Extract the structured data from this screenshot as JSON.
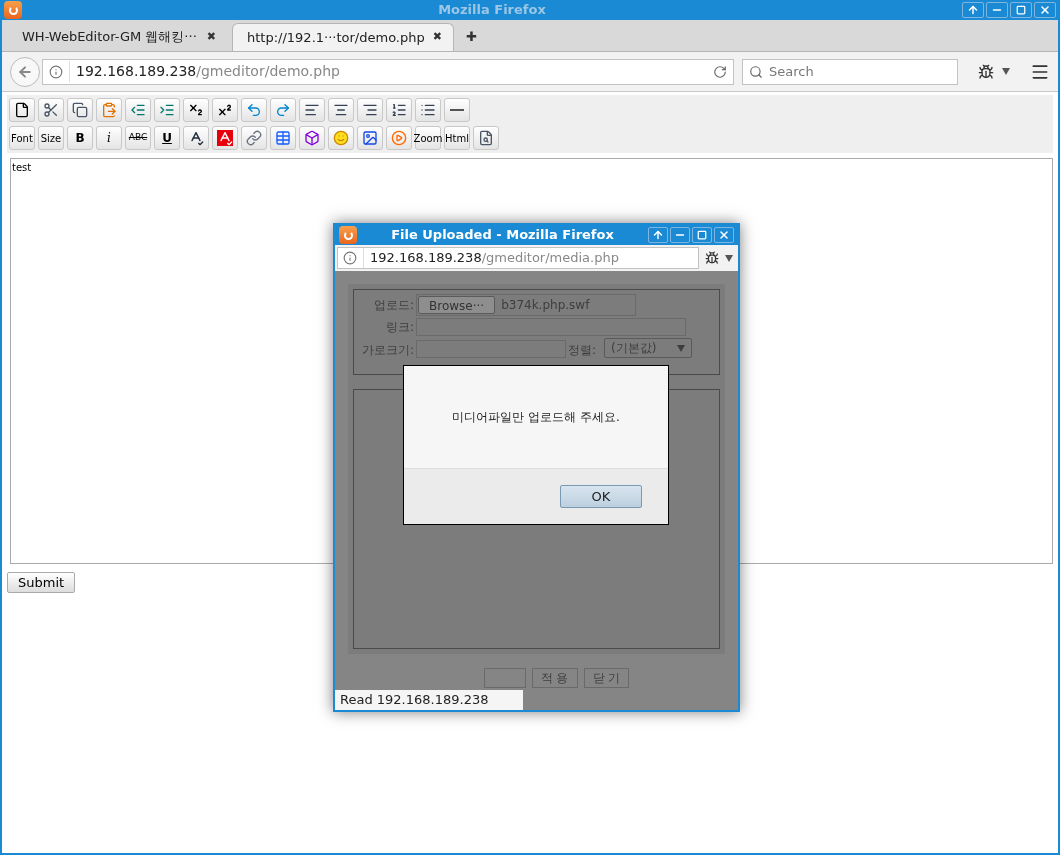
{
  "window": {
    "title": "Mozilla Firefox"
  },
  "tabs": [
    {
      "label": "WH-WebEditor-GM 웹해킹···",
      "close": "✖",
      "selected": false
    },
    {
      "label": "http://192.1···tor/demo.php",
      "close": "✖",
      "selected": true
    }
  ],
  "new_tab": "✚",
  "address_bar": {
    "host": "192.168.189.238",
    "path": "/gmeditor/demo.php"
  },
  "search": {
    "placeholder": "Search"
  },
  "toolbar": [
    [
      {
        "kind": "icon"
      },
      {
        "kind": "icon"
      },
      {
        "kind": "icon"
      },
      {
        "kind": "icon"
      },
      {
        "kind": "icon"
      },
      {
        "kind": "icon"
      },
      {
        "kind": "icon"
      },
      {
        "kind": "icon"
      },
      {
        "kind": "icon"
      },
      {
        "kind": "icon"
      },
      {
        "kind": "icon"
      },
      {
        "kind": "icon"
      },
      {
        "kind": "icon"
      },
      {
        "kind": "icon"
      },
      {
        "kind": "icon"
      },
      {
        "kind": "icon"
      }
    ],
    [
      {
        "kind": "text",
        "label": "Font"
      },
      {
        "kind": "text",
        "label": "Size"
      },
      {
        "kind": "bold",
        "label": "B"
      },
      {
        "kind": "italic",
        "label": "i"
      },
      {
        "kind": "strike",
        "label": "ABC"
      },
      {
        "kind": "underline",
        "label": "U"
      },
      {
        "kind": "icon"
      },
      {
        "kind": "icon"
      },
      {
        "kind": "icon"
      },
      {
        "kind": "icon"
      },
      {
        "kind": "icon"
      },
      {
        "kind": "icon"
      },
      {
        "kind": "icon"
      },
      {
        "kind": "icon"
      },
      {
        "kind": "text",
        "label": "Zoom"
      },
      {
        "kind": "text",
        "label": "Html"
      },
      {
        "kind": "icon"
      }
    ]
  ],
  "editor": {
    "value": "test"
  },
  "submit": "Submit",
  "popup": {
    "title": "File Uploaded - Mozilla Firefox",
    "address_bar": {
      "host": "192.168.189.238",
      "path": "/gmeditor/media.php"
    },
    "form": {
      "upload_label": "업로드:",
      "browse": "Browse···",
      "file": "b374k.php.swf",
      "link_label": "링크:",
      "width_label": "가로크기:",
      "align_label": "정렬:",
      "align_value": "(기본값)"
    },
    "buttons": [
      "적 용",
      "닫 기"
    ],
    "status": "Read 192.168.189.238"
  },
  "alert": {
    "message": "미디어파일만 업로드해 주세요.",
    "ok": "OK"
  }
}
